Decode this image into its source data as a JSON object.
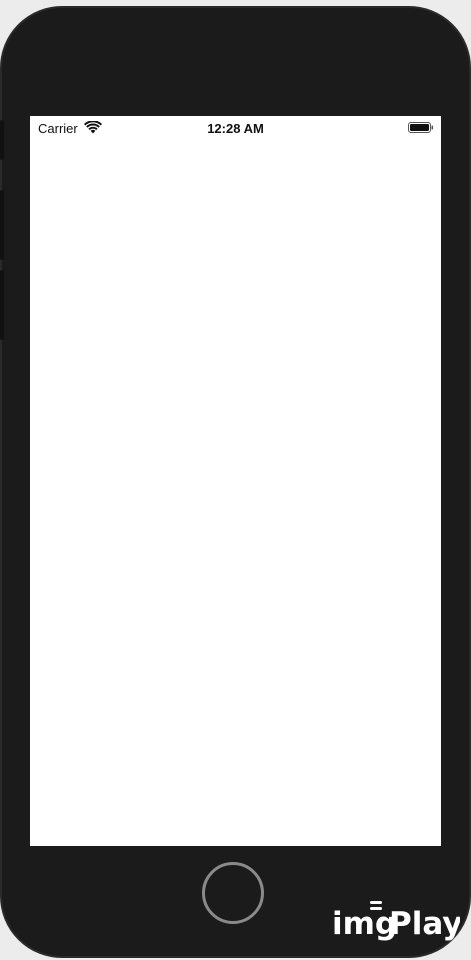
{
  "status_bar": {
    "carrier": "Carrier",
    "time": "12:28 AM",
    "wifi_icon": "wifi-icon",
    "battery_icon": "battery-icon"
  },
  "device": {
    "home_button_icon": "home-button"
  },
  "watermark": {
    "text": "imgPlay"
  },
  "colors": {
    "device_frame": "#1b1b1b",
    "screen_background": "#ffffff",
    "status_text": "#111111"
  }
}
